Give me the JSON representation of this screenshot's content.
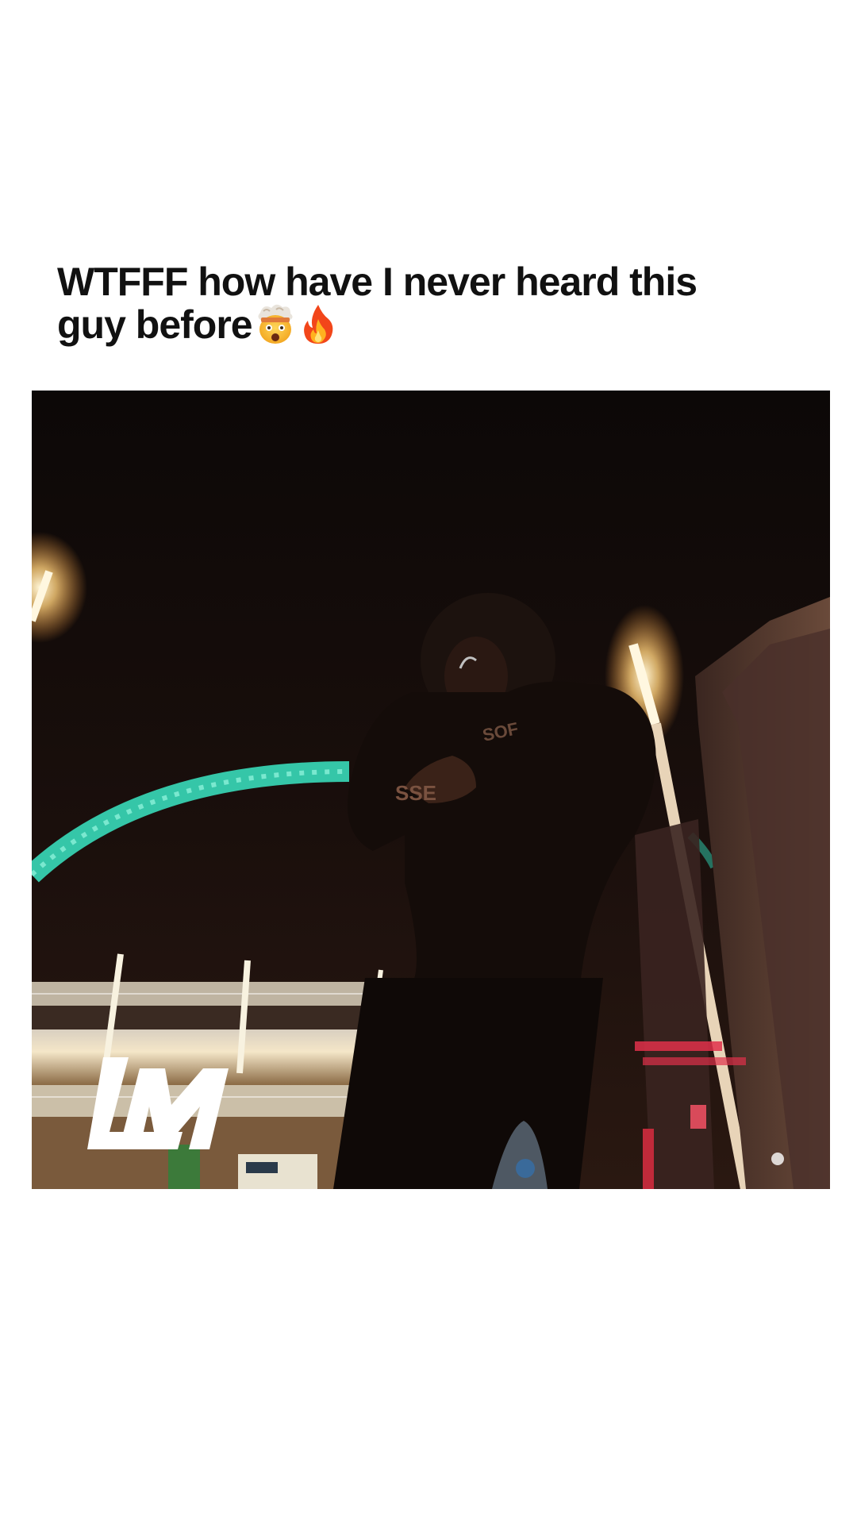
{
  "post": {
    "caption_line1": "WTFFF how have I never heard this",
    "caption_line2": "guy before",
    "caption_emojis": [
      "exploding-head-emoji",
      "fire-emoji"
    ]
  },
  "media": {
    "type": "video-frame",
    "watermark_logo": "LM",
    "scene": "night-stadium-arch",
    "colors": {
      "arch": "#35c6a8",
      "sky": "#110a08",
      "lights": "#fff2c8",
      "accent_red": "#e0304a"
    }
  }
}
